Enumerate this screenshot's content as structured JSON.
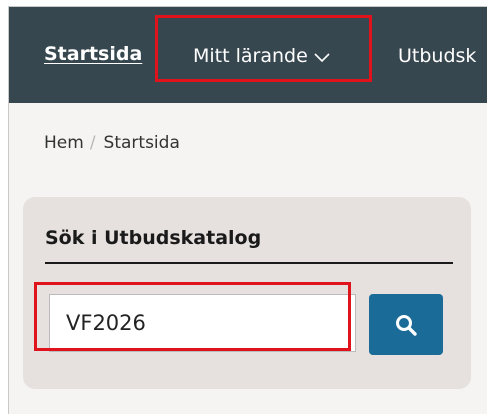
{
  "nav": {
    "home_label": "Startsida",
    "learning_label": "Mitt lärande",
    "catalog_label": "Utbudsk"
  },
  "breadcrumb": {
    "items": [
      "Hem",
      "Startsida"
    ],
    "separator": "/"
  },
  "search": {
    "title": "Sök i Utbudskatalog",
    "value": "VF2026",
    "button_icon": "search-icon"
  },
  "colors": {
    "nav_background": "#37474f",
    "search_button": "#1a6b97",
    "highlight": "#e0121b",
    "card_background": "#e6e1de",
    "page_background": "#f5f4f3"
  }
}
